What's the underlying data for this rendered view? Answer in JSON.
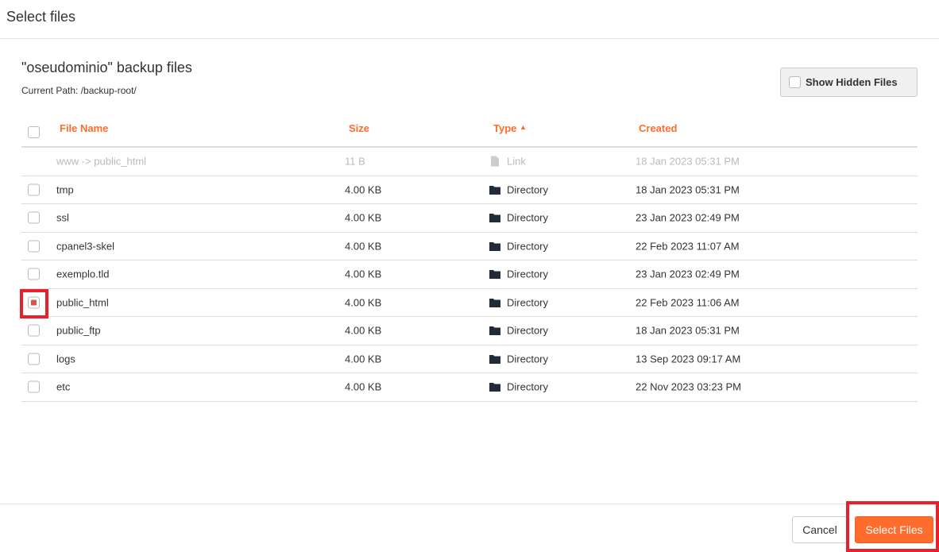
{
  "dialog": {
    "title": "Select files"
  },
  "header": {
    "title": "\"oseudominio\" backup files",
    "path": "Current Path: /backup-root/",
    "show_hidden_label": "Show Hidden Files"
  },
  "columns": {
    "name": "File Name",
    "size": "Size",
    "type": "Type",
    "created": "Created"
  },
  "rows": [
    {
      "name": "www -> public_html",
      "size": "11 B",
      "type": "Link",
      "icon": "file-icon",
      "created": "18 Jan 2023 05:31 PM",
      "disabled": true,
      "checked": false
    },
    {
      "name": "tmp",
      "size": "4.00 KB",
      "type": "Directory",
      "icon": "folder-icon",
      "created": "18 Jan 2023 05:31 PM",
      "checked": false
    },
    {
      "name": "ssl",
      "size": "4.00 KB",
      "type": "Directory",
      "icon": "folder-icon",
      "created": "23 Jan 2023 02:49 PM",
      "checked": false
    },
    {
      "name": "cpanel3-skel",
      "size": "4.00 KB",
      "type": "Directory",
      "icon": "folder-icon",
      "created": "22 Feb 2023 11:07 AM",
      "checked": false
    },
    {
      "name": "exemplo.tld",
      "size": "4.00 KB",
      "type": "Directory",
      "icon": "folder-icon",
      "created": "23 Jan 2023 02:49 PM",
      "checked": false
    },
    {
      "name": "public_html",
      "size": "4.00 KB",
      "type": "Directory",
      "icon": "folder-icon",
      "created": "22 Feb 2023 11:06 AM",
      "checked": true
    },
    {
      "name": "public_ftp",
      "size": "4.00 KB",
      "type": "Directory",
      "icon": "folder-icon",
      "created": "18 Jan 2023 05:31 PM",
      "checked": false
    },
    {
      "name": "logs",
      "size": "4.00 KB",
      "type": "Directory",
      "icon": "folder-icon",
      "created": "13 Sep 2023 09:17 AM",
      "checked": false
    },
    {
      "name": "etc",
      "size": "4.00 KB",
      "type": "Directory",
      "icon": "folder-icon",
      "created": "22 Nov 2023 03:23 PM",
      "checked": false
    }
  ],
  "footer": {
    "cancel": "Cancel",
    "select": "Select Files"
  },
  "colors": {
    "accent": "#ff6c2c",
    "highlight": "#e8202a",
    "checked": "#d9534f"
  }
}
